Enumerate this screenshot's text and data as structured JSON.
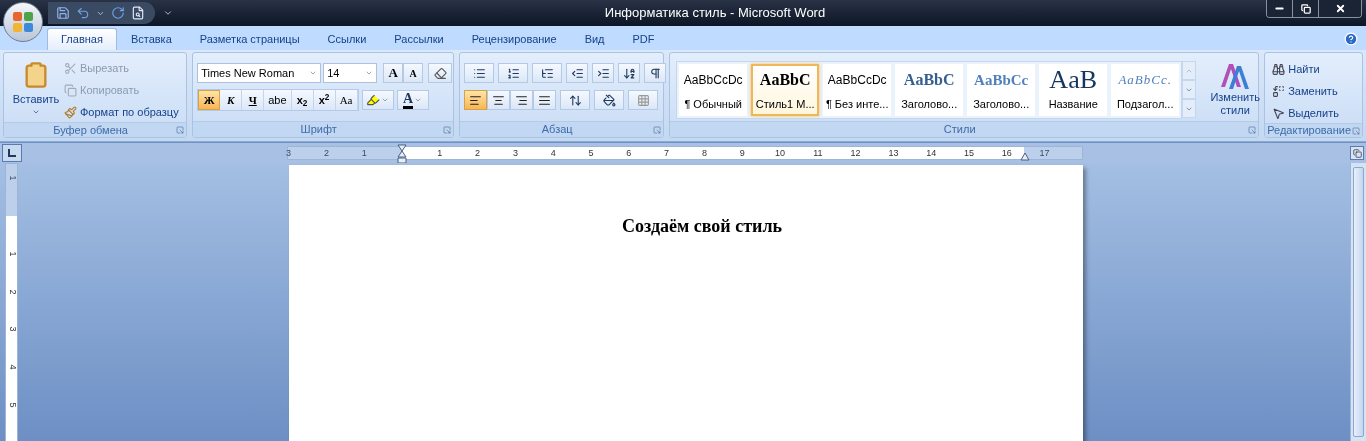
{
  "window": {
    "title": "Информатика стиль - Microsoft Word"
  },
  "tabs": [
    {
      "label": "Главная",
      "selected": true
    },
    {
      "label": "Вставка",
      "selected": false
    },
    {
      "label": "Разметка страницы",
      "selected": false
    },
    {
      "label": "Ссылки",
      "selected": false
    },
    {
      "label": "Рассылки",
      "selected": false
    },
    {
      "label": "Рецензирование",
      "selected": false
    },
    {
      "label": "Вид",
      "selected": false
    },
    {
      "label": "PDF",
      "selected": false
    }
  ],
  "clipboard": {
    "title": "Буфер обмена",
    "paste": "Вставить",
    "items": [
      {
        "label": "Вырезать",
        "disabled": true
      },
      {
        "label": "Копировать",
        "disabled": true
      },
      {
        "label": "Формат по образцу",
        "disabled": false
      }
    ]
  },
  "font": {
    "title": "Шрифт",
    "name": "Times New Roman",
    "size": "14",
    "grow": "A",
    "shrink": "A",
    "color_letter": "A",
    "buttons": [
      {
        "label": "Ж",
        "selected": true,
        "kind": "bold"
      },
      {
        "label": "К",
        "selected": false,
        "kind": "italic"
      },
      {
        "label": "Ч",
        "selected": false,
        "kind": "underline"
      },
      {
        "label": "abe",
        "selected": false,
        "kind": "strike"
      },
      {
        "label": "x$_{2}$",
        "selected": false,
        "kind": "plain"
      },
      {
        "label": "x$^{2}$",
        "selected": false,
        "kind": "plain"
      },
      {
        "label": "Aa",
        "selected": false,
        "kind": "serif"
      }
    ]
  },
  "paragraph": {
    "title": "Абзац",
    "align": [
      {
        "kind": "left",
        "selected": true
      },
      {
        "kind": "center",
        "selected": false
      },
      {
        "kind": "right",
        "selected": false
      },
      {
        "kind": "justify",
        "selected": false
      }
    ]
  },
  "styles": {
    "title": "Стили",
    "change": "Изменить стили",
    "items": [
      {
        "preview": "AaBbCcDc",
        "name": "¶ Обычный",
        "kind": "normal",
        "selected": false
      },
      {
        "preview": "AaBbC",
        "name": "Стиль1 М...",
        "kind": "strong",
        "selected": true
      },
      {
        "preview": "AaBbCcDc",
        "name": "¶ Без инте...",
        "kind": "normal",
        "selected": false
      },
      {
        "preview": "AaBbC",
        "name": "Заголово...",
        "kind": "heading1",
        "selected": false
      },
      {
        "preview": "AaBbCc",
        "name": "Заголово...",
        "kind": "heading2",
        "selected": false
      },
      {
        "preview": "AaB",
        "name": "Название",
        "kind": "title",
        "selected": false
      },
      {
        "preview": "AaBbCc.",
        "name": "Подзагол...",
        "kind": "subtitle",
        "selected": false
      }
    ]
  },
  "editing": {
    "title": "Редактирование",
    "items": [
      {
        "label": "Найти",
        "kind": "find"
      },
      {
        "label": "Заменить",
        "kind": "replace"
      },
      {
        "label": "Выделить",
        "kind": "select"
      }
    ]
  },
  "ruler": {
    "labels": [
      {
        "label": "3",
        "kind": "margin"
      },
      {
        "label": "2",
        "kind": "margin"
      },
      {
        "label": "1",
        "kind": "margin"
      },
      {
        "label": "1",
        "kind": "text"
      },
      {
        "label": "2",
        "kind": "text"
      },
      {
        "label": "3",
        "kind": "text"
      },
      {
        "label": "4",
        "kind": "text"
      },
      {
        "label": "5",
        "kind": "text"
      },
      {
        "label": "6",
        "kind": "text"
      },
      {
        "label": "7",
        "kind": "text"
      },
      {
        "label": "8",
        "kind": "text"
      },
      {
        "label": "9",
        "kind": "text"
      },
      {
        "label": "10",
        "kind": "text"
      },
      {
        "label": "11",
        "kind": "text"
      },
      {
        "label": "12",
        "kind": "text"
      },
      {
        "label": "13",
        "kind": "text"
      },
      {
        "label": "14",
        "kind": "text"
      },
      {
        "label": "15",
        "kind": "text"
      },
      {
        "label": "16",
        "kind": "text"
      },
      {
        "label": "17",
        "kind": "margin"
      }
    ]
  },
  "vruler": {
    "labels": [
      {
        "label": "1",
        "kind": "margin"
      },
      {
        "label": "1",
        "kind": "text"
      },
      {
        "label": "2",
        "kind": "text"
      },
      {
        "label": "3",
        "kind": "text"
      },
      {
        "label": "4",
        "kind": "text"
      },
      {
        "label": "5",
        "kind": "text"
      }
    ]
  },
  "document": {
    "heading": "Создаём свой стиль"
  }
}
